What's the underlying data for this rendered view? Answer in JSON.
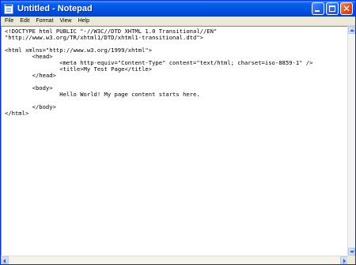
{
  "window": {
    "title": "Untitled - Notepad",
    "icons": {
      "app": "notepad-icon",
      "minimize": "minimize-icon",
      "maximize": "maximize-icon",
      "close": "close-icon"
    },
    "close_glyph": "✕"
  },
  "menu": {
    "items": [
      "File",
      "Edit",
      "Format",
      "View",
      "Help"
    ]
  },
  "editor": {
    "content": "<!DOCTYPE html PUBLIC \"-//W3C//DTD XHTML 1.0 Transitional//EN\"\n\"http://www.w3.org/TR/xhtml1/DTD/xhtml1-transitional.dtd\">\n\n<html xmlns=\"http://www.w3.org/1999/xhtml\">\n\t<head>\n\t\t<meta http-equiv=\"Content-Type\" content=\"text/html; charset=iso-8859-1\" />\n\t\t<title>My Test Page</title>\n\t</head>\n\n\t<body>\n\t\tHello World! My page content starts here.\n\n\t</body>\n</html>"
  },
  "colors": {
    "titlebar": "#0054e3",
    "menubar": "#ece9d8",
    "editor_bg": "#ffffff",
    "close_button": "#e0512a"
  }
}
